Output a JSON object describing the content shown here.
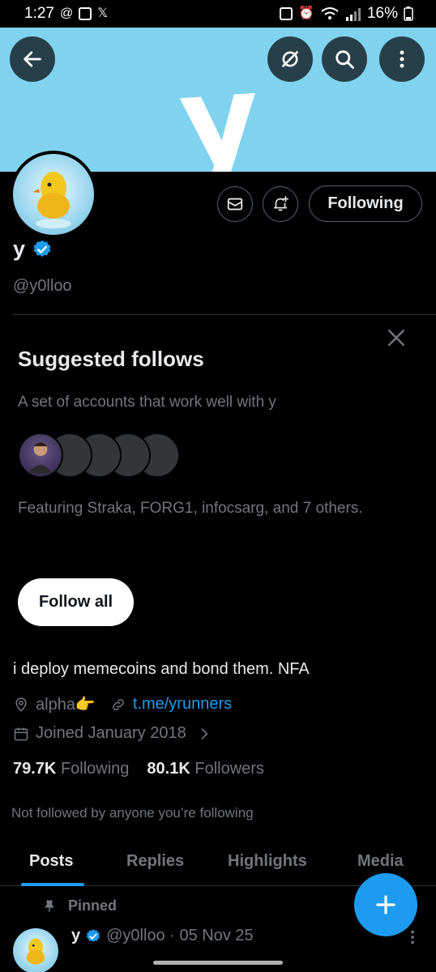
{
  "status_bar": {
    "time": "1:27",
    "battery": "16%"
  },
  "banner": {
    "letter": "y"
  },
  "profile_actions": {
    "following_label": "Following"
  },
  "profile": {
    "display_name": "y",
    "handle": "@y0lloo",
    "bio": "i deploy memecoins and bond them. NFA",
    "location": "alpha👉",
    "link": "t.me/yrunners",
    "joined": "Joined January 2018",
    "following_count": "79.7K",
    "following_label": "Following",
    "followers_count": "80.1K",
    "followers_label": "Followers",
    "not_followed": "Not followed by anyone you’re following"
  },
  "suggested": {
    "title": "Suggested follows",
    "subtitle": "A set of accounts that work well with y",
    "featuring": "Featuring Straka, FORG1, infocsarg, and 7 others.",
    "follow_all_label": "Follow all"
  },
  "tabs": [
    {
      "label": "Posts",
      "active": true
    },
    {
      "label": "Replies",
      "active": false
    },
    {
      "label": "Highlights",
      "active": false
    },
    {
      "label": "Media",
      "active": false
    }
  ],
  "pinned": {
    "label": "Pinned",
    "name": "y",
    "handle_date": "@y0lloo · 05 Nov 25"
  },
  "colors": {
    "accent": "#1d9bf0",
    "banner": "#7fd3ef",
    "background": "#000000"
  }
}
